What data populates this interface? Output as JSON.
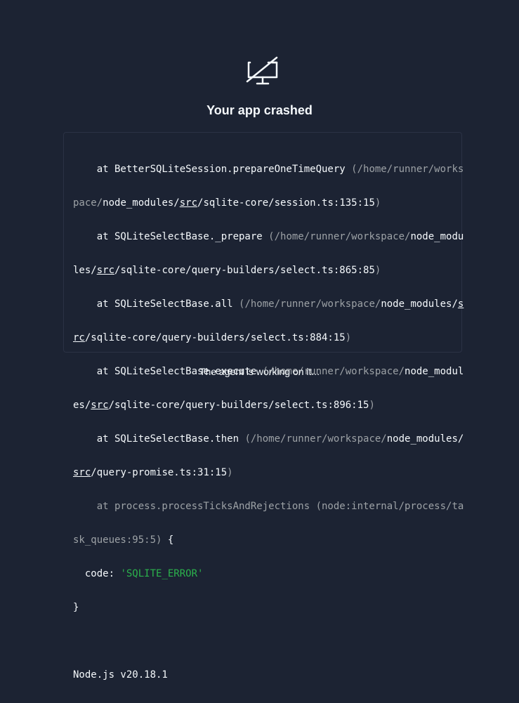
{
  "header": {
    "icon": "monitor-off-icon",
    "title": "Your app crashed"
  },
  "error_output": {
    "lines": [
      [
        {
          "t": "    at BetterSQLiteSession.prepareOneTimeQuery "
        },
        {
          "t": "(/home/runner/works"
        }
      ],
      [
        {
          "t": "pace/"
        },
        {
          "t": "node_modules/"
        },
        {
          "t": "src"
        },
        {
          "t": "/sqlite-core/session.ts:135:15"
        },
        {
          "t": ")"
        }
      ],
      [
        {
          "t": "    at SQLiteSelectBase._prepare "
        },
        {
          "t": "(/home/runner/workspace/"
        },
        {
          "t": "node_modu"
        }
      ],
      [
        {
          "t": "les/"
        },
        {
          "t": "src"
        },
        {
          "t": "/sqlite-core/query-builders/select.ts:865:85"
        },
        {
          "t": ")"
        }
      ],
      [
        {
          "t": "    at SQLiteSelectBase.all "
        },
        {
          "t": "(/home/runner/workspace/"
        },
        {
          "t": "node_modules/"
        },
        {
          "t": "s"
        }
      ],
      [
        {
          "t": "rc"
        },
        {
          "t": "/sqlite-core/query-builders/select.ts:884:15"
        },
        {
          "t": ")"
        }
      ],
      [
        {
          "t": "    at SQLiteSelectBase.execute "
        },
        {
          "t": "(/home/runner/workspace/"
        },
        {
          "t": "node_modul"
        }
      ],
      [
        {
          "t": "es/"
        },
        {
          "t": "src"
        },
        {
          "t": "/sqlite-core/query-builders/select.ts:896:15"
        },
        {
          "t": ")"
        }
      ],
      [
        {
          "t": "    at SQLiteSelectBase.then "
        },
        {
          "t": "(/home/runner/workspace/"
        },
        {
          "t": "node_modules/"
        }
      ],
      [
        {
          "t": "src"
        },
        {
          "t": "/query-promise.ts:31:15"
        },
        {
          "t": ")"
        }
      ],
      [
        {
          "t": "    at process.processTicksAndRejections (node:internal/process/ta"
        }
      ],
      [
        {
          "t": "sk_queues:95:5)"
        },
        {
          "t": " {"
        }
      ],
      [
        {
          "t": "  code: "
        },
        {
          "t": "'SQLITE_ERROR'"
        }
      ],
      [
        {
          "t": "}"
        }
      ],
      [
        {
          "t": ""
        }
      ],
      [
        {
          "t": "Node.js v20.18.1"
        }
      ]
    ]
  },
  "status": {
    "text": "The agent is working on it..."
  },
  "colors": {
    "background": "#1c2333",
    "text": "#f5f9fc",
    "dim": "#9da2a6",
    "string": "#2bb24c"
  }
}
